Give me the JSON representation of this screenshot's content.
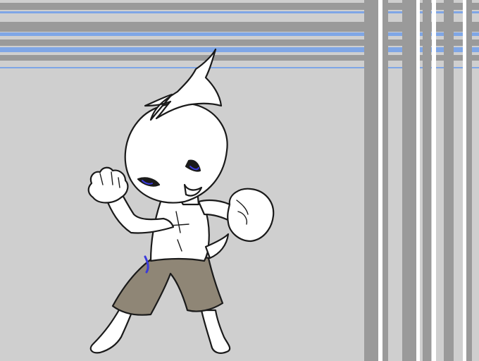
{
  "artwork": {
    "background_color": "#cfcfcf",
    "stripe_gray": "#9a9a9a",
    "stripe_blue": "#7fa6e6",
    "stripe_white": "#ffffff",
    "figure_fill": "#ffffff",
    "figure_shade": "#e4e0ef",
    "outline": "#1a1a1a",
    "shorts_fill": "#8f8676",
    "eye_blue": "#3a3adc"
  }
}
